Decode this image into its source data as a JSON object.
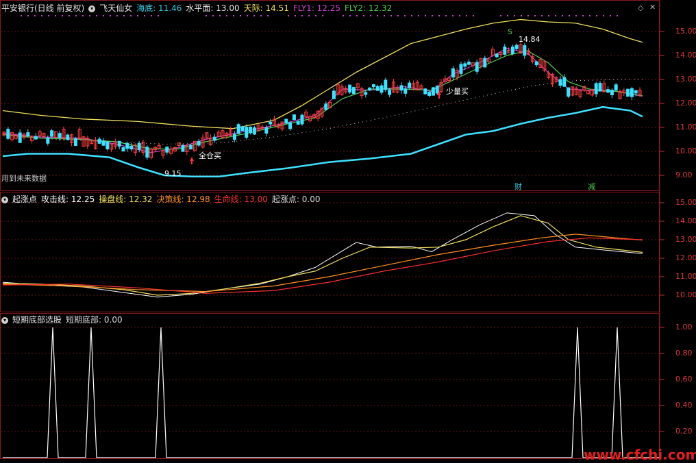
{
  "main_panel": {
    "stock_label": "平安银行(日线 前复权)",
    "indicator_label": "飞天仙女",
    "values": [
      {
        "name": "海底:",
        "value": "11.46",
        "color": "#36c8e0"
      },
      {
        "name": "水平面:",
        "value": "13.00",
        "color": "#e8e8e8"
      },
      {
        "name": "天际:",
        "value": "14.51",
        "color": "#f0e060"
      },
      {
        "name": "FLY1:",
        "value": "12.25",
        "color": "#d040d0"
      },
      {
        "name": "FLY2:",
        "value": "12.32",
        "color": "#50d050"
      }
    ],
    "y_ticks": [
      "15.00",
      "14.00",
      "13.00",
      "12.00",
      "11.00",
      "10.00",
      "9.00"
    ],
    "annotations": {
      "buy_all": "全仓买",
      "buy_small": "少量买",
      "low_price": "9.15",
      "high_price": "14.84",
      "s_mark": "S",
      "cai_mark": "财",
      "jian_mark": "减",
      "future_note": "用到未来数据"
    }
  },
  "mid_panel": {
    "indicator_label": "起涨点",
    "values": [
      {
        "name": "攻击线:",
        "value": "12.25",
        "color": "#ffffff"
      },
      {
        "name": "操盘线:",
        "value": "12.32",
        "color": "#f0e060"
      },
      {
        "name": "决策线:",
        "value": "12.98",
        "color": "#ff9020"
      },
      {
        "name": "生命线:",
        "value": "13.00",
        "color": "#ff3030"
      },
      {
        "name": "起涨点:",
        "value": "0.00",
        "color": "#dddddd"
      }
    ],
    "y_ticks": [
      "15.00",
      "14.00",
      "13.00",
      "12.00",
      "11.00",
      "10.00"
    ]
  },
  "bottom_panel": {
    "indicator_label": "短期底部选股",
    "values": [
      {
        "name": "短期底部:",
        "value": "0.00",
        "color": "#dddddd"
      }
    ],
    "y_ticks": [
      "1.00",
      "0.80",
      "0.60",
      "0.40",
      "0.20"
    ]
  },
  "watermark": "www.cfchi.com",
  "colors": {
    "grid": "#8b1a1a",
    "up": "#ff4040",
    "down": "#40e0ff"
  }
}
